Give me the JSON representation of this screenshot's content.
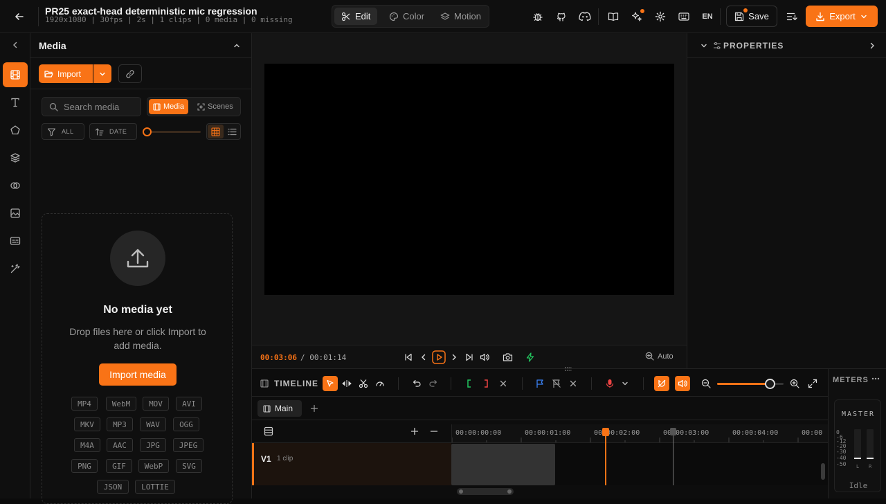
{
  "project": {
    "title": "PR25 exact-head deterministic mic regression",
    "meta": "1920x1080 | 30fps | 2s | 1 clips | 0 media | 0 missing"
  },
  "modes": [
    {
      "label": "Edit",
      "icon": "scissors-icon",
      "active": true
    },
    {
      "label": "Color",
      "icon": "palette-icon",
      "active": false
    },
    {
      "label": "Motion",
      "icon": "layers-icon",
      "active": false
    }
  ],
  "topbar": {
    "language": "EN",
    "save_label": "Save",
    "export_label": "Export",
    "icons": [
      "bug-icon",
      "github-icon",
      "discord-icon",
      "book-icon",
      "sparkle-icon",
      "gear-icon",
      "keyboard-icon"
    ]
  },
  "rail": {
    "items": [
      "film-icon",
      "text-icon",
      "shape-icon",
      "layers-icon",
      "transitions-icon",
      "sticker-icon",
      "captions-icon",
      "magic-wand-icon"
    ],
    "active_index": 0
  },
  "media": {
    "title": "Media",
    "import_label": "Import",
    "search_placeholder": "Search media",
    "tab_media": "Media",
    "tab_scenes": "Scenes",
    "filter_label": "ALL",
    "sort_label": "DATE",
    "empty_title": "No media yet",
    "empty_desc": "Drop files here or click Import to add media.",
    "import_media_label": "Import media",
    "formats": [
      [
        "MP4",
        "WebM",
        "MOV",
        "AVI"
      ],
      [
        "MKV",
        "MP3",
        "WAV",
        "OGG"
      ],
      [
        "M4A",
        "AAC",
        "JPG",
        "JPEG"
      ],
      [
        "PNG",
        "GIF",
        "WebP",
        "SVG"
      ],
      [
        "JSON",
        "LOTTIE"
      ]
    ]
  },
  "preview": {
    "current_time": "00:03:06",
    "separator": "/",
    "duration": "00:01:14",
    "zoom_label": "Auto"
  },
  "properties": {
    "title": "PROPERTIES"
  },
  "timeline": {
    "title": "TIMELINE",
    "sequence_tab": "Main",
    "ruler": [
      "00:00:00:00",
      "00:00:01:00",
      "00:00:02:00",
      "00:00:03:00",
      "00:00:04:00",
      "00:00"
    ],
    "zoom_fraction": 0.8,
    "track": {
      "name": "V1",
      "sub": "1 clip"
    },
    "colors": {
      "accent": "#f97316",
      "mark_in": "#22c55e",
      "mark_out": "#ef4444",
      "marker": "#3b82f6",
      "record": "#ef4444"
    }
  },
  "meters": {
    "title": "METERS",
    "master_label": "MASTER",
    "scale": [
      "0",
      "-6",
      "-12",
      "-20",
      "-30",
      "-40",
      "-50"
    ],
    "channels": [
      "L",
      "R"
    ],
    "status": "Idle"
  }
}
